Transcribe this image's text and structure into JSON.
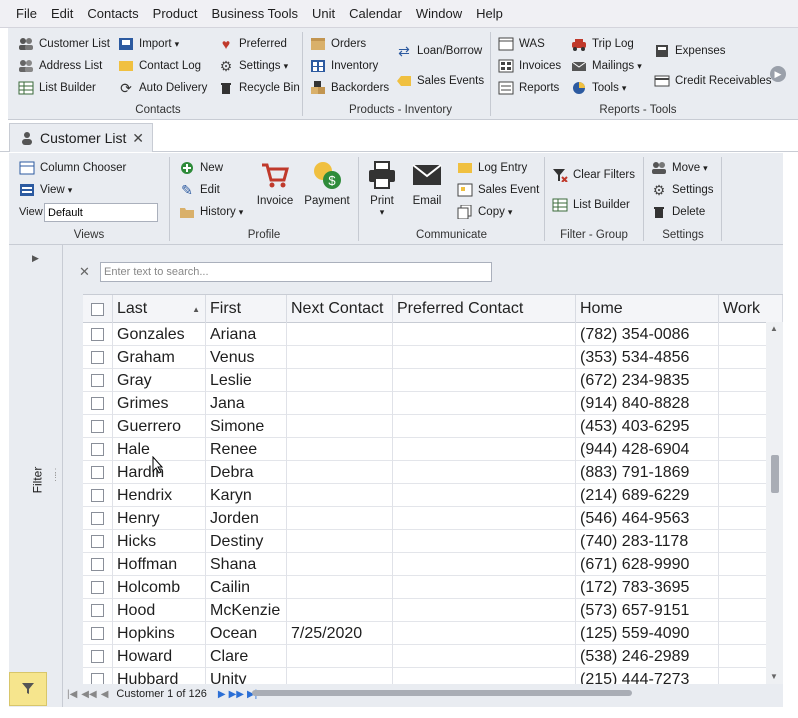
{
  "menu": [
    "File",
    "Edit",
    "Contacts",
    "Product",
    "Business Tools",
    "Unit",
    "Calendar",
    "Window",
    "Help"
  ],
  "ribbon_main": {
    "contacts": {
      "label": "Contacts",
      "customer_list": "Customer List",
      "address_list": "Address List",
      "list_builder": "List Builder",
      "import": "Import",
      "contact_log": "Contact Log",
      "auto_delivery": "Auto Delivery",
      "preferred": "Preferred",
      "settings": "Settings",
      "recycle_bin": "Recycle Bin"
    },
    "products": {
      "label": "Products - Inventory",
      "orders": "Orders",
      "inventory": "Inventory",
      "backorders": "Backorders",
      "loan_borrow": "Loan/Borrow",
      "sales_events": "Sales Events"
    },
    "reports": {
      "label": "Reports - Tools",
      "was": "WAS",
      "invoices": "Invoices",
      "reports": "Reports",
      "trip_log": "Trip Log",
      "mailings": "Mailings",
      "tools": "Tools",
      "expenses": "Expenses",
      "credit_receivables": "Credit Receivables"
    }
  },
  "tab": {
    "label": "Customer List"
  },
  "ribbon_sub": {
    "views": {
      "label": "Views",
      "column_chooser": "Column Chooser",
      "view": "View",
      "view_label": "View",
      "view_value": "Default"
    },
    "profile": {
      "label": "Profile",
      "new": "New",
      "edit": "Edit",
      "history": "History",
      "invoice": "Invoice",
      "payment": "Payment"
    },
    "communicate": {
      "label": "Communicate",
      "print": "Print",
      "email": "Email",
      "log_entry": "Log Entry",
      "sales_event": "Sales Event",
      "copy": "Copy"
    },
    "filter_group": {
      "label": "Filter - Group",
      "clear_filters": "Clear Filters",
      "list_builder": "List Builder"
    },
    "settings": {
      "label": "Settings",
      "move": "Move",
      "settings": "Settings",
      "delete": "Delete"
    }
  },
  "left_panel": {
    "filter_label": "Filter"
  },
  "search": {
    "placeholder": "Enter text to search..."
  },
  "grid": {
    "columns": [
      "Last",
      "First",
      "Next Contact",
      "Preferred Contact",
      "Home",
      "Work"
    ],
    "rows": [
      [
        "Gonzales",
        "Ariana",
        "",
        "",
        "(782) 354-0086"
      ],
      [
        "Graham",
        "Venus",
        "",
        "",
        "(353) 534-4856"
      ],
      [
        "Gray",
        "Leslie",
        "",
        "",
        "(672) 234-9835"
      ],
      [
        "Grimes",
        "Jana",
        "",
        "",
        "(914) 840-8828"
      ],
      [
        "Guerrero",
        "Simone",
        "",
        "",
        "(453) 403-6295"
      ],
      [
        "Hale",
        "Renee",
        "",
        "",
        "(944) 428-6904"
      ],
      [
        "Hardin",
        "Debra",
        "",
        "",
        "(883) 791-1869"
      ],
      [
        "Hendrix",
        "Karyn",
        "",
        "",
        "(214) 689-6229"
      ],
      [
        "Henry",
        "Jorden",
        "",
        "",
        "(546) 464-9563"
      ],
      [
        "Hicks",
        "Destiny",
        "",
        "",
        "(740) 283-1178"
      ],
      [
        "Hoffman",
        "Shana",
        "",
        "",
        "(671) 628-9990"
      ],
      [
        "Holcomb",
        "Cailin",
        "",
        "",
        "(172) 783-3695"
      ],
      [
        "Hood",
        "McKenzie",
        "",
        "",
        "(573) 657-9151"
      ],
      [
        "Hopkins",
        "Ocean",
        "7/25/2020",
        "",
        "(125) 559-4090"
      ],
      [
        "Howard",
        "Clare",
        "",
        "",
        "(538) 246-2989"
      ],
      [
        "Hubbard",
        "Unity",
        "",
        "",
        "(215) 444-7273"
      ]
    ]
  },
  "pager": {
    "label": "Customer 1 of 126"
  },
  "colors": {
    "accent": "#2b6fd6",
    "filter_button": "#f6e58d",
    "ribbon_bg": "#e9ecf1"
  }
}
